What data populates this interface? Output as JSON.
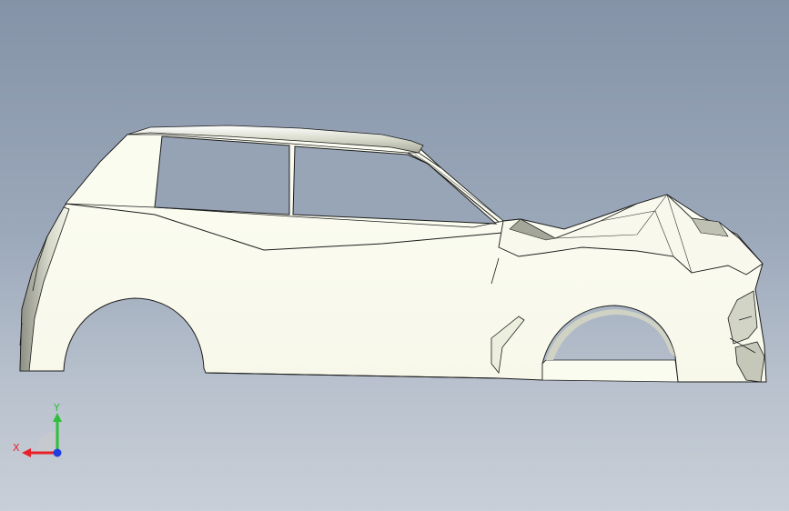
{
  "viewport": {
    "background_top": "#8593a8",
    "background_bottom": "#c9cfd8"
  },
  "model": {
    "body_color": "#fbfcf0",
    "shade_color": "#e4e6d6",
    "edge_color": "#1c1c1c"
  },
  "triad": {
    "x_label": "X",
    "y_label": "Y",
    "x_color": "#e8202a",
    "y_color": "#2fbf3a",
    "z_color": "#1f3fe0"
  }
}
